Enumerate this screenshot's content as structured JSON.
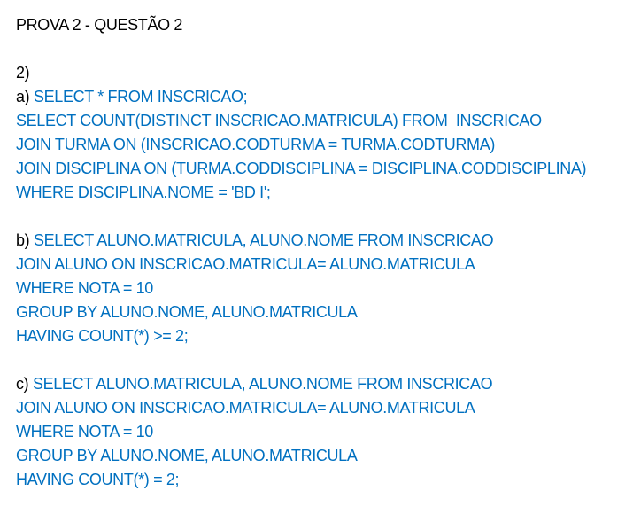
{
  "document": {
    "title": "PROVA 2 - QUESTÃO 2",
    "question_number": "2)",
    "colors": {
      "text": "#000000",
      "sql": "#0070c0",
      "background": "#ffffff"
    },
    "parts": [
      {
        "label": "a) ",
        "lines": [
          "SELECT * FROM INSCRICAO;",
          "SELECT COUNT(DISTINCT INSCRICAO.MATRICULA) FROM  INSCRICAO",
          "JOIN TURMA ON (INSCRICAO.CODTURMA = TURMA.CODTURMA)",
          "JOIN DISCIPLINA ON (TURMA.CODDISCIPLINA = DISCIPLINA.CODDISCIPLINA)",
          "WHERE DISCIPLINA.NOME = 'BD I';"
        ]
      },
      {
        "label": "b) ",
        "lines": [
          "SELECT ALUNO.MATRICULA, ALUNO.NOME FROM INSCRICAO",
          "JOIN ALUNO ON INSCRICAO.MATRICULA= ALUNO.MATRICULA",
          "WHERE NOTA = 10",
          "GROUP BY ALUNO.NOME, ALUNO.MATRICULA",
          "HAVING COUNT(*) >= 2;"
        ]
      },
      {
        "label": "c) ",
        "lines": [
          "SELECT ALUNO.MATRICULA, ALUNO.NOME FROM INSCRICAO",
          "JOIN ALUNO ON INSCRICAO.MATRICULA= ALUNO.MATRICULA",
          "WHERE NOTA = 10",
          "GROUP BY ALUNO.NOME, ALUNO.MATRICULA",
          "HAVING COUNT(*) = 2;"
        ]
      }
    ]
  }
}
